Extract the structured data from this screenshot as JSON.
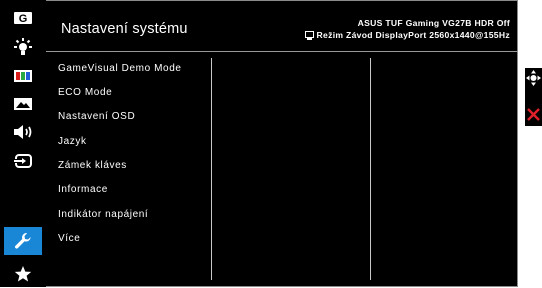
{
  "header": {
    "title": "Nastavení systému",
    "model_line": "ASUS TUF Gaming   VG27B HDR Off",
    "status_line": "Režim Závod  DisplayPort  2560x1440@155Hz"
  },
  "sidebar": {
    "items": [
      {
        "icon": "gamevisual-g-icon"
      },
      {
        "icon": "brightness-icon"
      },
      {
        "icon": "color-bars-icon"
      },
      {
        "icon": "image-icon"
      },
      {
        "icon": "sound-icon"
      },
      {
        "icon": "input-select-icon"
      },
      {
        "icon": "wrench-icon",
        "active": true
      },
      {
        "icon": "star-icon"
      }
    ]
  },
  "menu": {
    "items": [
      "GameVisual Demo Mode",
      "ECO Mode",
      "Nastavení OSD",
      "Jazyk",
      "Zámek kláves",
      "Informace",
      "Indikátor napájení",
      "Více"
    ]
  },
  "navigation": {
    "items": [
      {
        "icon": "joystick-move-icon"
      },
      {
        "icon": "close-icon"
      }
    ]
  },
  "colors": {
    "accent": "#1a86d6",
    "close": "#e0202a",
    "background": "#000000"
  }
}
